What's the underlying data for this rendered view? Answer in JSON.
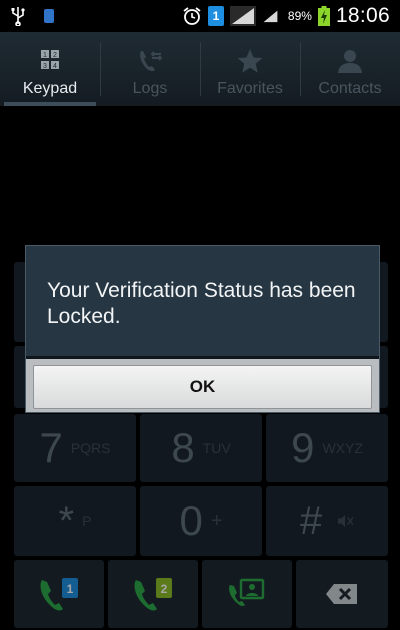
{
  "status_bar": {
    "battery_percent": "89%",
    "time": "18:06",
    "sim_number": "1",
    "icons": [
      "usb-icon",
      "memory-icon",
      "alarm-clock-icon",
      "sim-1-icon",
      "signal-bars-icon",
      "signal-bars-icon",
      "battery-charging-icon"
    ]
  },
  "tabs": [
    {
      "label": "Keypad",
      "icon": "keypad-icon",
      "active": true
    },
    {
      "label": "Logs",
      "icon": "call-logs-icon",
      "active": false
    },
    {
      "label": "Favorites",
      "icon": "star-icon",
      "active": false
    },
    {
      "label": "Contacts",
      "icon": "person-icon",
      "active": false
    }
  ],
  "keypad": {
    "keys": [
      {
        "digit": "7",
        "letters": "PQRS"
      },
      {
        "digit": "8",
        "letters": "TUV"
      },
      {
        "digit": "9",
        "letters": "WXYZ"
      },
      {
        "digit": "*",
        "letters": "P"
      },
      {
        "digit": "0",
        "letters": "+"
      },
      {
        "digit": "#",
        "letters": ""
      }
    ],
    "bottom_row": [
      {
        "icon": "call-sim1-icon",
        "sim": "1"
      },
      {
        "icon": "call-sim2-icon",
        "sim": "2"
      },
      {
        "icon": "video-call-icon"
      },
      {
        "icon": "backspace-icon"
      }
    ]
  },
  "dialog": {
    "message": "Your Verification Status has been Locked.",
    "ok_label": "OK"
  },
  "colors": {
    "dialog_bg": "#263642",
    "call_green": "#2fa84a",
    "sim1_blue": "#1e8fe0",
    "sim2_green": "#8cbd2a"
  }
}
